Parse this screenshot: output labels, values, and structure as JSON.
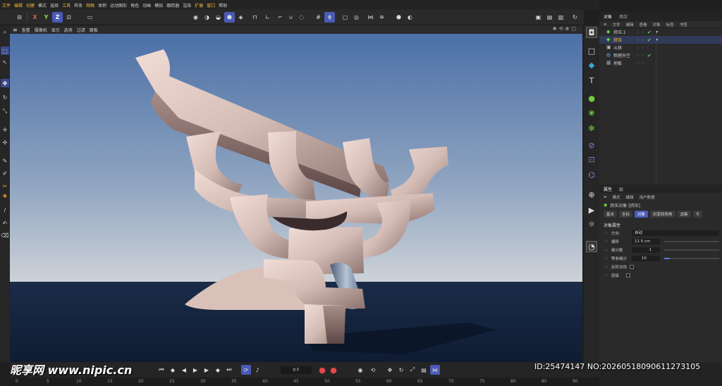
{
  "menubar": [
    "文件",
    "编辑",
    "创建",
    "模式",
    "选择",
    "工具",
    "样条",
    "网格",
    "体积",
    "运动图形",
    "角色",
    "动画",
    "模拟",
    "跟踪器",
    "渲染",
    "扩展",
    "窗口",
    "帮助"
  ],
  "toolbar": {
    "x": "X",
    "y": "Y",
    "z": "Z"
  },
  "viewport": {
    "menu": [
      "查看",
      "摄像机",
      "显示",
      "选项",
      "过滤",
      "面板"
    ],
    "colors": {
      "sky_top": "#4a6fa5",
      "sky_bottom": "#c9cfd6",
      "floor": "#13233d",
      "object": "#d8c3bd"
    }
  },
  "object_manager": {
    "tabs": [
      "对象",
      "场次"
    ],
    "menu": [
      "文件",
      "编辑",
      "查看",
      "对象",
      "标签",
      "书签"
    ],
    "rows": [
      {
        "name": "挤压.1",
        "icon": "extrude-icon",
        "check": "✔",
        "tag": "▾"
      },
      {
        "name": "挤压",
        "icon": "extrude-icon",
        "check": "✔",
        "tag": "▾"
      },
      {
        "name": "斗拱",
        "icon": "null-icon",
        "check": "",
        "tag": ""
      },
      {
        "name": "物理天空",
        "icon": "sky-icon",
        "check": "✔",
        "tag": ""
      },
      {
        "name": "地板",
        "icon": "floor-icon",
        "check": "",
        "tag": ""
      }
    ]
  },
  "attributes": {
    "tabs": [
      "属性",
      "层"
    ],
    "menu": [
      "模式",
      "编辑",
      "用户数据"
    ],
    "object_title": "挤压对象 [挤压]",
    "subtabs": [
      "基本",
      "坐标",
      "对象",
      "封盖和倒角",
      "选集",
      "平"
    ],
    "section": "对象属性",
    "rows": [
      {
        "label": "方向",
        "value": "自动",
        "slider": null
      },
      {
        "label": "偏移",
        "value": "11.5 cm",
        "slider": 0.0
      },
      {
        "label": "细分数",
        "value": "1",
        "slider": 0.0
      },
      {
        "label": "等参细分",
        "value": "10",
        "slider": 0.1
      }
    ],
    "checkboxes": [
      {
        "label": "反转法线"
      },
      {
        "label": "层级"
      }
    ]
  },
  "timeline": {
    "current_frame": "0 F",
    "ruler": [
      "0",
      "5",
      "10",
      "15",
      "20",
      "25",
      "30",
      "35",
      "40",
      "45",
      "50",
      "55",
      "60",
      "65",
      "70",
      "75",
      "80",
      "85",
      "90"
    ]
  },
  "watermark": {
    "left": "昵享网 www.nipic.cn",
    "right": "ID:25474147 NO:20260518090611273105"
  }
}
